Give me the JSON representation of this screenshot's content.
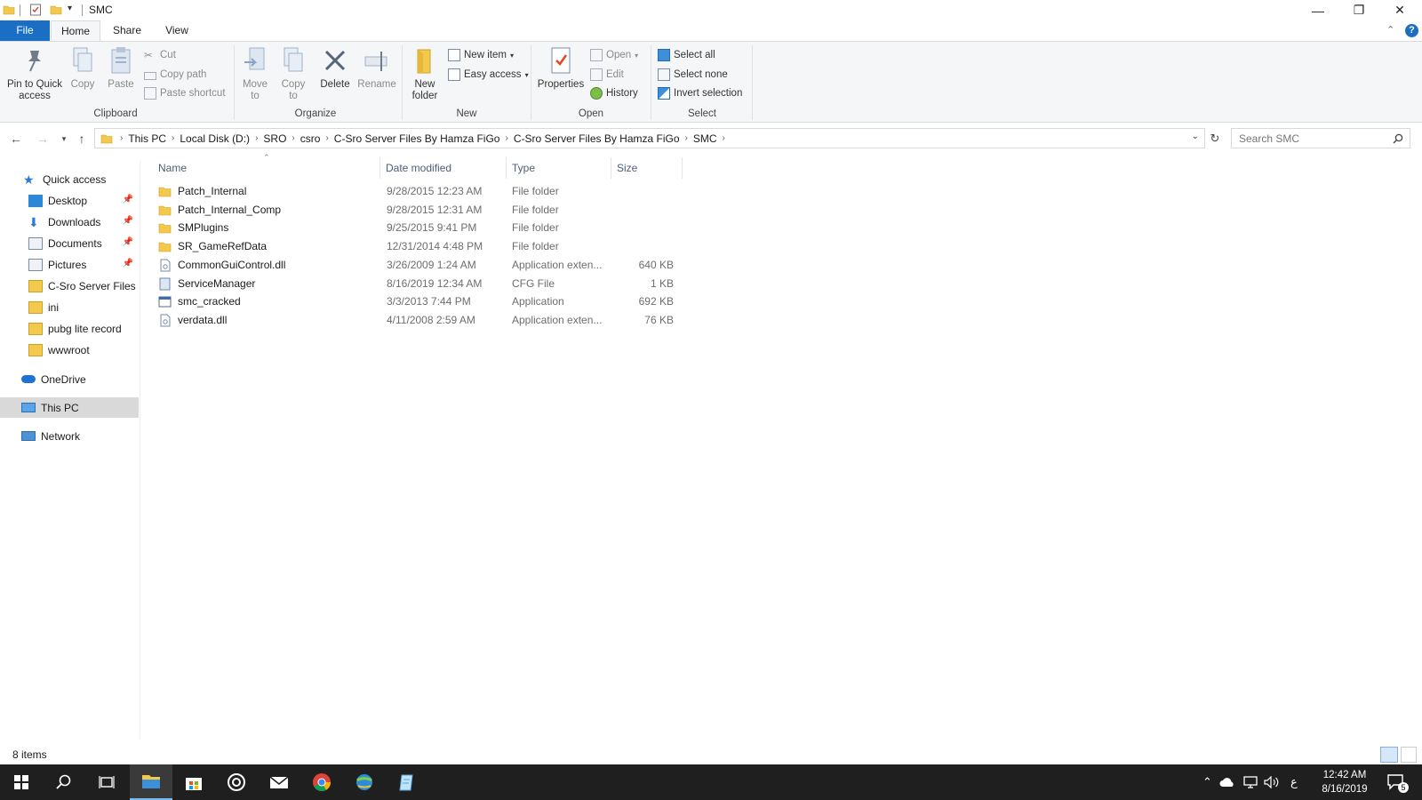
{
  "window": {
    "title": "SMC",
    "controls": {
      "minimize": "—",
      "restore": "❐",
      "close": "✕"
    }
  },
  "ribbon_tabs": [
    "File",
    "Home",
    "Share",
    "View"
  ],
  "ribbon": {
    "clipboard": {
      "label": "Clipboard",
      "pin": "Pin to Quick access",
      "copy": "Copy",
      "paste": "Paste",
      "cut": "Cut",
      "copy_path": "Copy path",
      "paste_shortcut": "Paste shortcut"
    },
    "organize": {
      "label": "Organize",
      "move_to": "Move to",
      "copy_to": "Copy to",
      "delete": "Delete",
      "rename": "Rename"
    },
    "new": {
      "label": "New",
      "new_folder": "New folder",
      "new_item": "New item",
      "easy_access": "Easy access"
    },
    "open": {
      "label": "Open",
      "properties": "Properties",
      "open": "Open",
      "edit": "Edit",
      "history": "History"
    },
    "select": {
      "label": "Select",
      "select_all": "Select all",
      "select_none": "Select none",
      "invert": "Invert selection"
    }
  },
  "address": {
    "crumbs": [
      "This PC",
      "Local Disk (D:)",
      "SRO",
      "csro",
      "C-Sro Server Files By Hamza FiGo",
      "C-Sro Server Files By Hamza FiGo",
      "SMC"
    ],
    "search_placeholder": "Search SMC"
  },
  "sidebar": {
    "quick_access": "Quick access",
    "items": [
      {
        "label": "Desktop",
        "pinned": true
      },
      {
        "label": "Downloads",
        "pinned": true
      },
      {
        "label": "Documents",
        "pinned": true
      },
      {
        "label": "Pictures",
        "pinned": true
      },
      {
        "label": "C-Sro Server Files By",
        "pinned": false
      },
      {
        "label": "ini",
        "pinned": false
      },
      {
        "label": "pubg lite record",
        "pinned": false
      },
      {
        "label": "wwwroot",
        "pinned": false
      }
    ],
    "onedrive": "OneDrive",
    "this_pc": "This PC",
    "network": "Network"
  },
  "columns": {
    "name": "Name",
    "date": "Date modified",
    "type": "Type",
    "size": "Size"
  },
  "files": [
    {
      "name": "Patch_Internal",
      "date": "9/28/2015 12:23 AM",
      "type": "File folder",
      "size": "",
      "kind": "folder"
    },
    {
      "name": "Patch_Internal_Comp",
      "date": "9/28/2015 12:31 AM",
      "type": "File folder",
      "size": "",
      "kind": "folder"
    },
    {
      "name": "SMPlugins",
      "date": "9/25/2015 9:41 PM",
      "type": "File folder",
      "size": "",
      "kind": "folder"
    },
    {
      "name": "SR_GameRefData",
      "date": "12/31/2014 4:48 PM",
      "type": "File folder",
      "size": "",
      "kind": "folder"
    },
    {
      "name": "CommonGuiControl.dll",
      "date": "3/26/2009 1:24 AM",
      "type": "Application exten...",
      "size": "640 KB",
      "kind": "dll"
    },
    {
      "name": "ServiceManager",
      "date": "8/16/2019 12:34 AM",
      "type": "CFG File",
      "size": "1 KB",
      "kind": "cfg"
    },
    {
      "name": "smc_cracked",
      "date": "3/3/2013 7:44 PM",
      "type": "Application",
      "size": "692 KB",
      "kind": "app"
    },
    {
      "name": "verdata.dll",
      "date": "4/11/2008 2:59 AM",
      "type": "Application exten...",
      "size": "76 KB",
      "kind": "dll"
    }
  ],
  "status": {
    "items_count": "8 items"
  },
  "taskbar": {
    "time": "12:42 AM",
    "date": "8/16/2019",
    "lang": "ع",
    "notifications": "5"
  },
  "colors": {
    "accent": "#1a6fc4",
    "folder": "#f2c94c",
    "taskbar": "#1f1f1f"
  }
}
